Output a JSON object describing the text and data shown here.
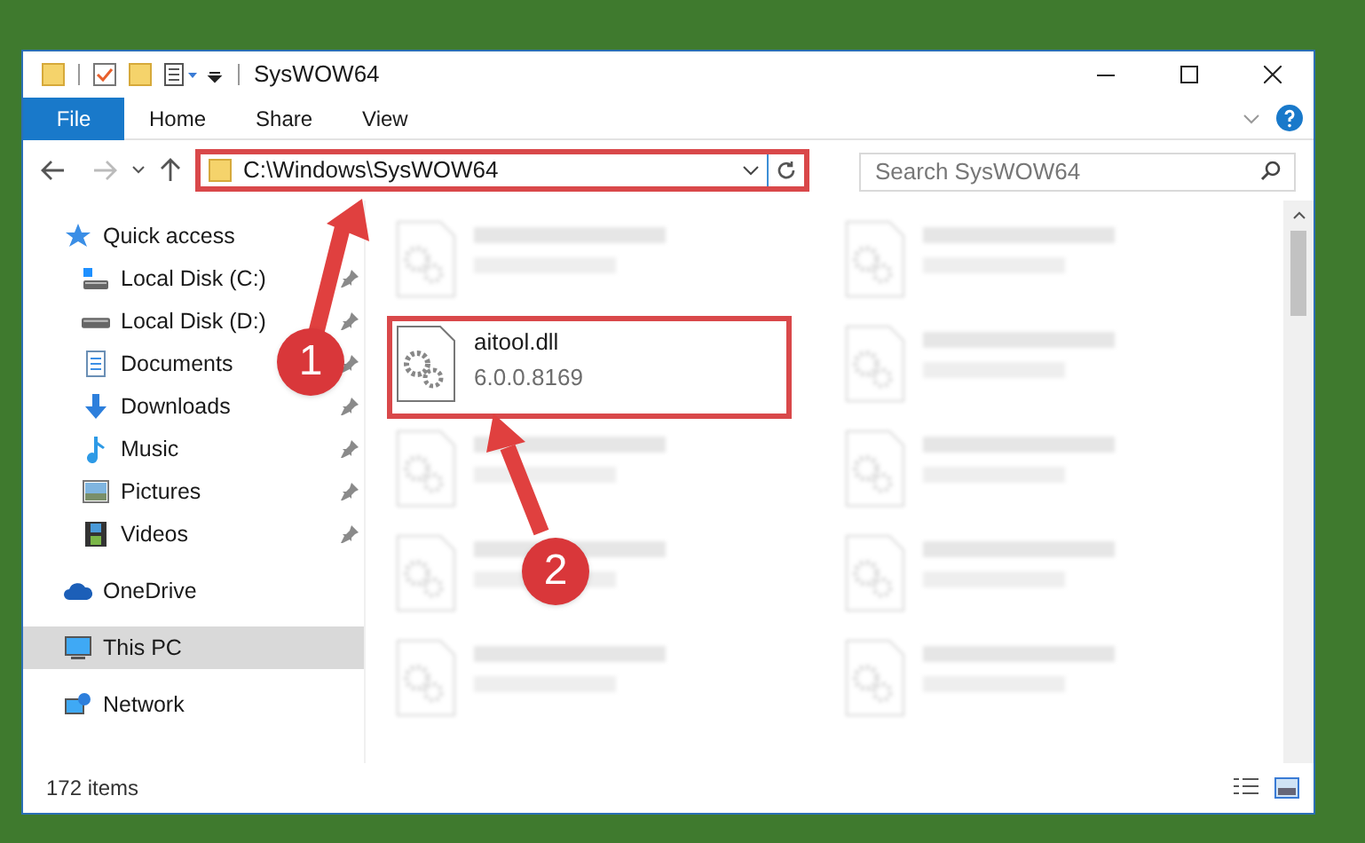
{
  "window": {
    "title": "SysWOW64"
  },
  "ribbon": {
    "tabs": [
      {
        "label": "File",
        "kind": "file",
        "selected": false
      },
      {
        "label": "Home",
        "kind": "tab",
        "selected": false
      },
      {
        "label": "Share",
        "kind": "tab",
        "selected": false
      },
      {
        "label": "View",
        "kind": "tab",
        "selected": false
      }
    ]
  },
  "address_bar": {
    "path": "C:\\Windows\\SysWOW64"
  },
  "search": {
    "placeholder": "Search SysWOW64"
  },
  "sidebar": {
    "items": [
      {
        "label": "Quick access",
        "selected": false,
        "children": [
          {
            "label": "Local Disk (C:)",
            "pinned": true,
            "selected": false
          },
          {
            "label": "Local Disk (D:)",
            "pinned": true,
            "selected": false
          },
          {
            "label": "Documents",
            "pinned": true,
            "selected": false
          },
          {
            "label": "Downloads",
            "pinned": true,
            "selected": false
          },
          {
            "label": "Music",
            "pinned": true,
            "selected": false
          },
          {
            "label": "Pictures",
            "pinned": true,
            "selected": false
          },
          {
            "label": "Videos",
            "pinned": true,
            "selected": false
          }
        ]
      },
      {
        "label": "OneDrive",
        "selected": false
      },
      {
        "label": "This PC",
        "selected": true
      },
      {
        "label": "Network",
        "selected": false
      }
    ]
  },
  "files": [
    {
      "kind": "blurred"
    },
    {
      "kind": "blurred"
    },
    {
      "kind": "highlighted",
      "name": "aitool.dll",
      "detail": "6.0.0.8169"
    },
    {
      "kind": "blurred"
    },
    {
      "kind": "blurred"
    },
    {
      "kind": "blurred"
    },
    {
      "kind": "blurred"
    },
    {
      "kind": "blurred"
    },
    {
      "kind": "blurred"
    },
    {
      "kind": "blurred"
    }
  ],
  "status_bar": {
    "item_count": "172 items"
  },
  "annotations": [
    {
      "number": "1"
    },
    {
      "number": "2"
    }
  ]
}
